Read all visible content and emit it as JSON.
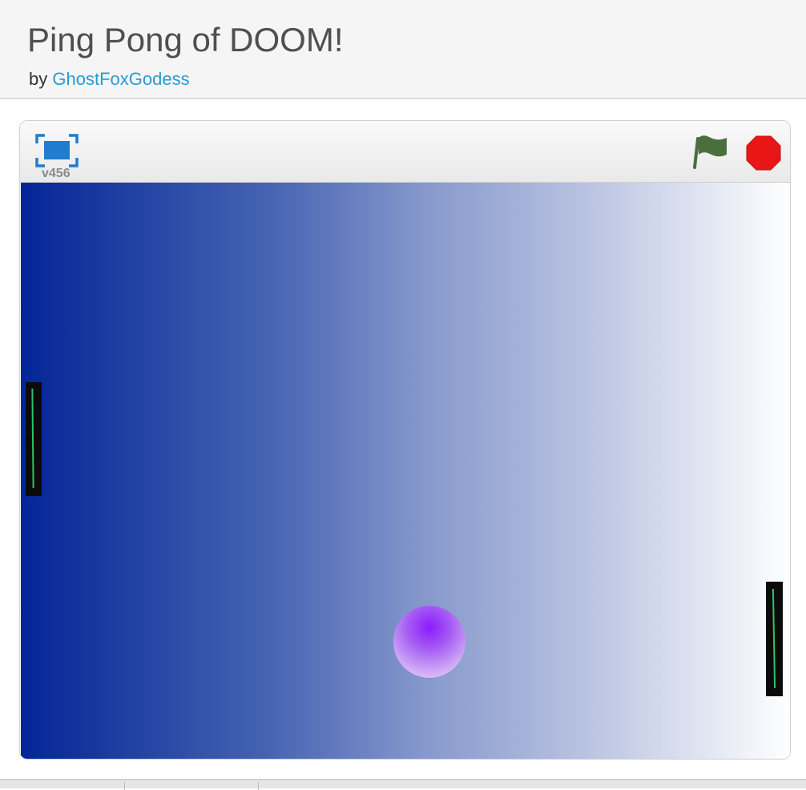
{
  "header": {
    "title": "Ping Pong of DOOM!",
    "by_label": "by",
    "author": "GhostFoxGodess"
  },
  "player": {
    "version": "v456",
    "icons": {
      "fullscreen": "fullscreen-icon",
      "green_flag": "green-flag-icon",
      "stop": "stop-icon"
    }
  },
  "colors": {
    "title_text": "#4f4f4f",
    "author_link": "#279bd4",
    "stage_gradient_start": "#042597",
    "stage_gradient_end": "#ffffff",
    "paddle": "#0b0b0b",
    "paddle_stripe": "#2fc26a",
    "ball_center": "#8d1bff",
    "ball_edge": "#eedcfd",
    "flag": "#4a6e3d",
    "stop": "#e81617",
    "fullscreen_icon": "#1f7ccf"
  }
}
